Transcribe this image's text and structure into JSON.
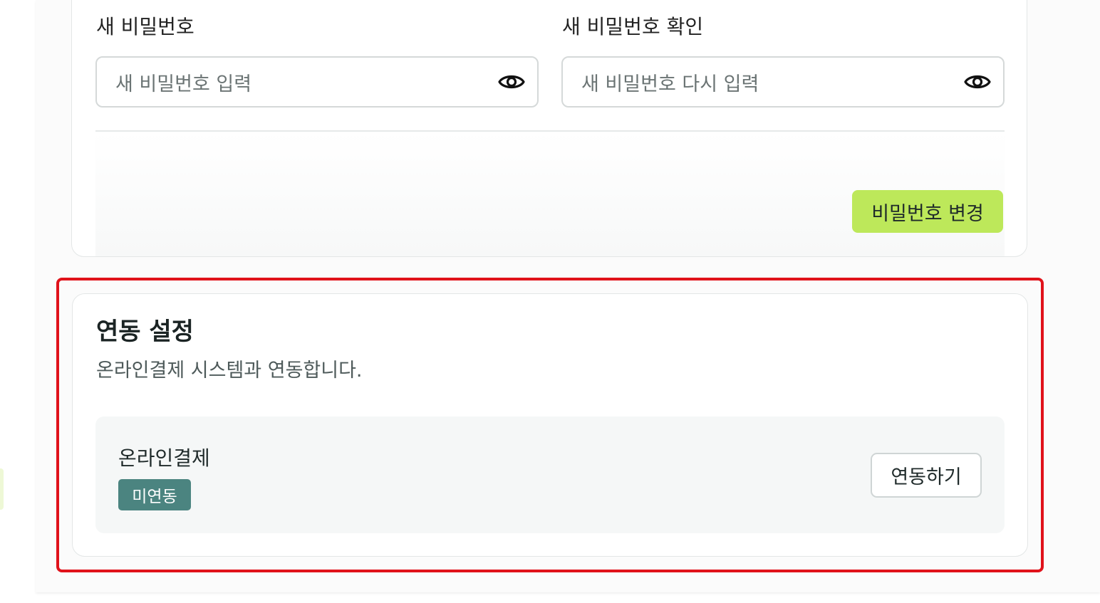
{
  "password_section": {
    "new_password_label": "새 비밀번호",
    "new_password_placeholder": "새 비밀번호 입력",
    "confirm_password_label": "새 비밀번호 확인",
    "confirm_password_placeholder": "새 비밀번호 다시 입력",
    "change_button_label": "비밀번호 변경",
    "visibility_icon": "eye-icon"
  },
  "integration_section": {
    "title": "연동 설정",
    "description": "온라인결제 시스템과 연동합니다.",
    "service": {
      "name": "온라인결제",
      "status": "미연동",
      "connect_button_label": "연동하기"
    }
  },
  "colors": {
    "accent_button": "#bde85a",
    "status_badge": "#4b8480",
    "highlight_border": "#e0121a"
  }
}
